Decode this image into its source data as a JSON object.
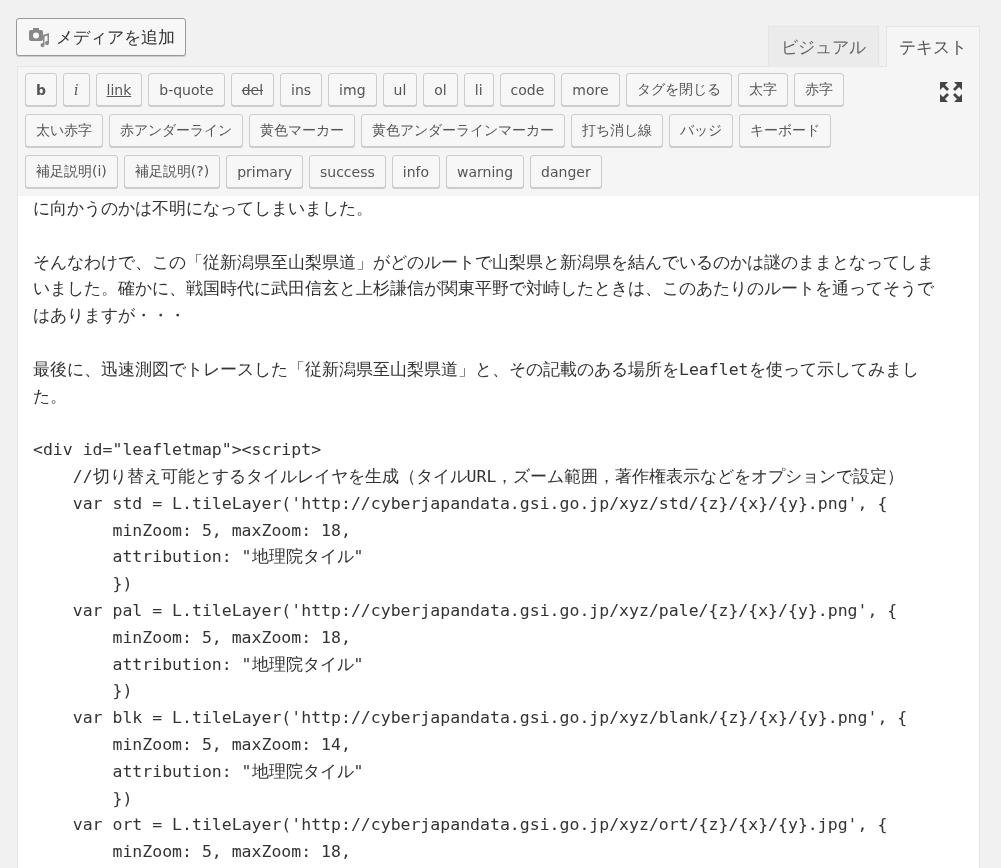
{
  "media_button": {
    "label": "メディアを追加"
  },
  "tabs": [
    {
      "label": "ビジュアル",
      "selected": false
    },
    {
      "label": "テキスト",
      "selected": true
    }
  ],
  "toolbar": {
    "buttons": [
      {
        "label": "b",
        "kind": "bold"
      },
      {
        "label": "i",
        "kind": "italic"
      },
      {
        "label": "link",
        "kind": "link"
      },
      {
        "label": "b-quote",
        "kind": "plain"
      },
      {
        "label": "del",
        "kind": "strike"
      },
      {
        "label": "ins",
        "kind": "plain"
      },
      {
        "label": "img",
        "kind": "plain"
      },
      {
        "label": "ul",
        "kind": "plain"
      },
      {
        "label": "ol",
        "kind": "plain"
      },
      {
        "label": "li",
        "kind": "plain"
      },
      {
        "label": "code",
        "kind": "plain"
      },
      {
        "label": "more",
        "kind": "plain"
      },
      {
        "label": "タグを閉じる",
        "kind": "plain"
      },
      {
        "label": "太字",
        "kind": "plain"
      },
      {
        "label": "赤字",
        "kind": "plain"
      },
      {
        "label": "太い赤字",
        "kind": "plain"
      },
      {
        "label": "赤アンダーライン",
        "kind": "plain"
      },
      {
        "label": "黄色マーカー",
        "kind": "plain"
      },
      {
        "label": "黄色アンダーラインマーカー",
        "kind": "plain"
      },
      {
        "label": "打ち消し線",
        "kind": "plain"
      },
      {
        "label": "バッジ",
        "kind": "plain"
      },
      {
        "label": "キーボード",
        "kind": "plain"
      },
      {
        "label": "補足説明(i)",
        "kind": "plain"
      },
      {
        "label": "補足説明(?)",
        "kind": "plain"
      },
      {
        "label": "primary",
        "kind": "plain"
      },
      {
        "label": "success",
        "kind": "plain"
      },
      {
        "label": "info",
        "kind": "plain"
      },
      {
        "label": "warning",
        "kind": "plain"
      },
      {
        "label": "danger",
        "kind": "plain"
      }
    ]
  },
  "editor": {
    "blocks": [
      {
        "lines": [
          "に向かうのかは不明になってしまいました。"
        ]
      },
      {
        "lines": [
          "そんなわけで、この「従新潟県至山梨県道」がどのルートで山梨県と新潟県を結んでいるのかは謎のままとなってしまいました。確かに、戦国時代に武田信玄と上杉謙信が関東平野で対峙したときは、このあたりのルートを通ってそうではありますが・・・"
        ]
      },
      {
        "lines": [
          "最後に、迅速測図でトレースした「従新潟県至山梨県道」と、その記載のある場所をLeafletを使って示してみました。"
        ]
      },
      {
        "lines": [
          "<div id=\"leafletmap\"><script>",
          "    //切り替え可能とするタイルレイヤを生成（タイルURL，ズーム範囲，著作権表示などをオプションで設定）",
          "    var std = L.tileLayer('http://cyberjapandata.gsi.go.jp/xyz/std/{z}/{x}/{y}.png', {",
          "        minZoom: 5, maxZoom: 18,",
          "        attribution: \"地理院タイル\"",
          "        })",
          "    var pal = L.tileLayer('http://cyberjapandata.gsi.go.jp/xyz/pale/{z}/{x}/{y}.png', {",
          "        minZoom: 5, maxZoom: 18,",
          "        attribution: \"地理院タイル\"",
          "        })",
          "    var blk = L.tileLayer('http://cyberjapandata.gsi.go.jp/xyz/blank/{z}/{x}/{y}.png', {",
          "        minZoom: 5, maxZoom: 14,",
          "        attribution: \"地理院タイル\"",
          "        })",
          "    var ort = L.tileLayer('http://cyberjapandata.gsi.go.jp/xyz/ort/{z}/{x}/{y}.jpg', {",
          "        minZoom: 5, maxZoom: 18,"
        ]
      }
    ]
  }
}
